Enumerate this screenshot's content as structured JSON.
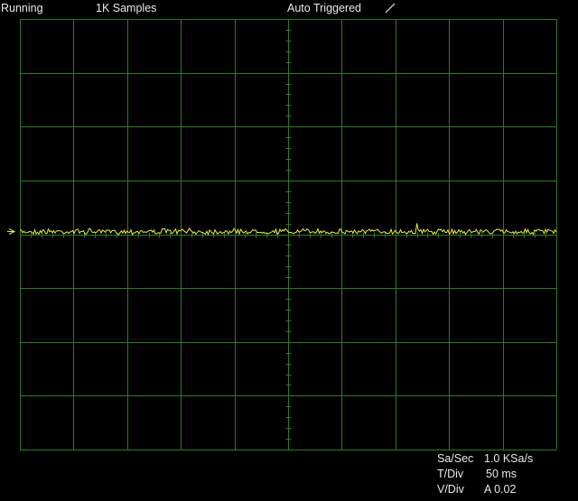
{
  "status_bar": {
    "run_state": "Running",
    "sample_count": "1K Samples",
    "trigger_mode": "Auto Triggered",
    "trigger_slope_icon": "rising-edge-slope"
  },
  "readouts": {
    "sample_rate_label": "Sa/Sec",
    "sample_rate_value": "1.0 KSa/s",
    "time_div_label": "T/Div",
    "time_div_value": "50 ms",
    "volt_div_label": "V/Div",
    "volt_div_value": "A 0.02"
  },
  "display": {
    "grid_divisions_horizontal": 10,
    "grid_divisions_vertical": 8,
    "grid_color": "#2f7a26",
    "trace_color": "#e8e84a",
    "background_color": "#000000",
    "trace_level_divisions": 0,
    "trace_description": "flat noise near ground level"
  }
}
